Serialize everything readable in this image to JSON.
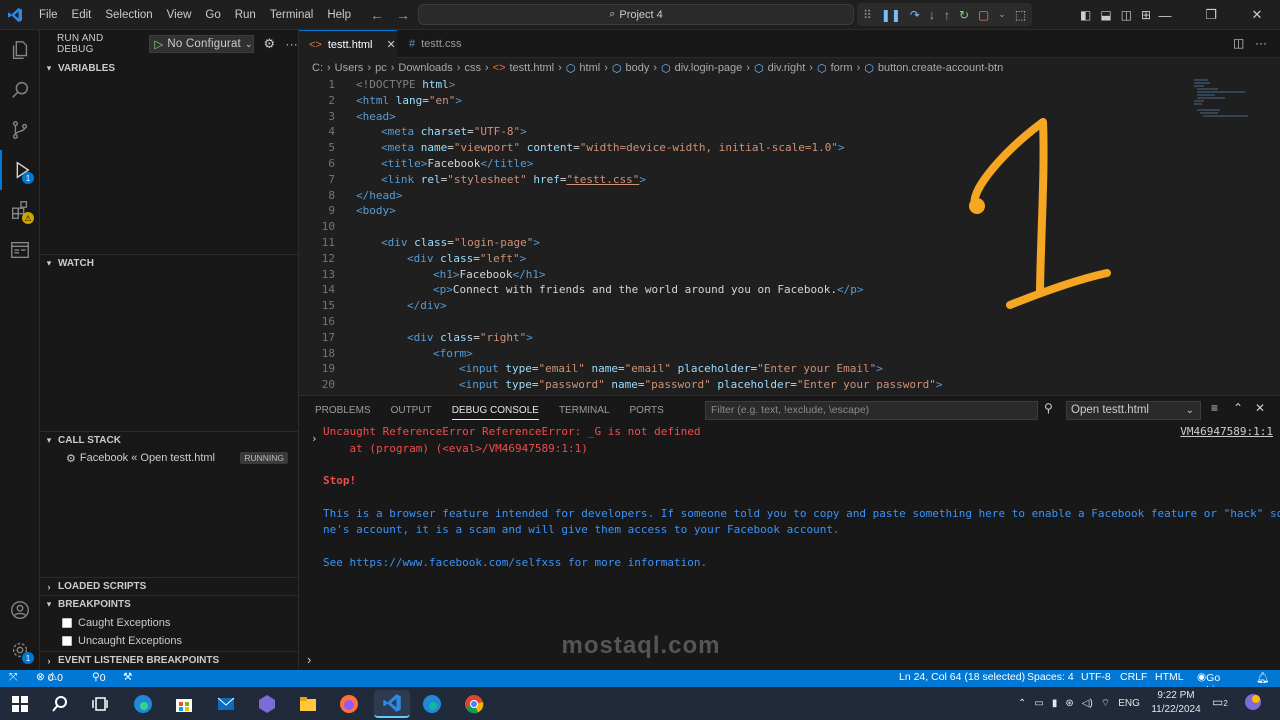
{
  "menu": [
    "File",
    "Edit",
    "Selection",
    "View",
    "Go",
    "Run",
    "Terminal",
    "Help"
  ],
  "command_center": "Project 4",
  "sidebar": {
    "title": "RUN AND DEBUG",
    "config": "No Configurat",
    "sections": {
      "variables": "VARIABLES",
      "watch": "WATCH",
      "call_stack": "CALL STACK",
      "loaded_scripts": "LOADED SCRIPTS",
      "breakpoints": "BREAKPOINTS",
      "event_listener": "EVENT LISTENER BREAKPOINTS"
    },
    "call_stack_item": "Facebook « Open testt.html",
    "call_stack_status": "RUNNING",
    "breakpoints": [
      "Caught Exceptions",
      "Uncaught Exceptions"
    ]
  },
  "activity_badges": {
    "debug": "1"
  },
  "tabs": [
    "testt.html",
    "testt.css"
  ],
  "breadcrumb": [
    "C:",
    "Users",
    "pc",
    "Downloads",
    "css",
    "testt.html",
    "html",
    "body",
    "div.login-page",
    "div.right",
    "form",
    "button.create-account-btn"
  ],
  "code_lines": [
    [
      "1",
      "2",
      "3",
      "4",
      "5",
      "6",
      "7",
      "8",
      "9",
      "10",
      "11",
      "12",
      "13",
      "14",
      "15",
      "16",
      "17",
      "18",
      "19",
      "20"
    ]
  ],
  "code": {
    "l1a": "<!DOCTYPE",
    "l1b": " html",
    "l1c": ">",
    "html_open": "<html",
    "lang_attr": " lang",
    "lang_val": "\"en\"",
    "head_open": "<head>",
    "meta1_tag": "<meta",
    "meta1_attr": " charset",
    "meta1_val": "\"UTF-8\"",
    "meta2_attr1": " name",
    "meta2_val1": "\"viewport\"",
    "meta2_attr2": " content",
    "meta2_val2": "\"width=device-width, initial-scale=1.0\"",
    "title_open": "<title>",
    "title_text": "Facebook",
    "title_close": "</title>",
    "link_tag": "<link",
    "link_rel": " rel",
    "link_rel_val": "\"stylesheet\"",
    "link_href": " href",
    "link_href_val": "\"testt.css\"",
    "head_close": "</head>",
    "body_open": "<body>",
    "div": "<div",
    "class_attr": " class",
    "login_val": "\"login-page\"",
    "left_val": "\"left\"",
    "h1_open": "<h1>",
    "h1_text": "Facebook",
    "h1_close": "</h1>",
    "p_open": "<p>",
    "p_text": "Connect with friends and the world around you on Facebook.",
    "p_close": "</p>",
    "div_close": "</div>",
    "right_val": "\"right\"",
    "form_open": "<form>",
    "input": "<input",
    "type_attr": " type",
    "email_val": "\"email\"",
    "name_attr": " name",
    "placeholder_attr": " placeholder",
    "email_ph": "\"Enter your Email\"",
    "password_val": "\"password\"",
    "password_ph": "\"Enter your password\"",
    "eq": "=",
    "gt": ">"
  },
  "panel": {
    "tabs": [
      "PROBLEMS",
      "OUTPUT",
      "DEBUG CONSOLE",
      "TERMINAL",
      "PORTS"
    ],
    "filter_placeholder": "Filter (e.g. text, !exclude, \\escape)",
    "session": "Open testt.html",
    "error_line1": "Uncaught ReferenceError ReferenceError: _G is not defined",
    "error_line2": "    at (program) (<eval>/VM46947589:1:1)",
    "error_source": "VM46947589:1:1",
    "stop": "Stop!",
    "warn1": "This is a browser feature intended for developers. If someone told you to copy and paste something here to enable a Facebook feature or \"hack\" someo",
    "warn2": "ne's account, it is a scam and will give them access to your Facebook account.",
    "warn3": "See https://www.facebook.com/selfxss for more information."
  },
  "statusbar": {
    "errors": "0",
    "warnings": "0",
    "ports": "0",
    "position": "Ln 24, Col 64 (18 selected)",
    "spaces": "Spaces: 4",
    "encoding": "UTF-8",
    "eol": "CRLF",
    "language": "HTML",
    "golive": "Go Live"
  },
  "taskbar": {
    "lang": "ENG",
    "time": "9:22 PM",
    "date": "11/22/2024",
    "notifications": "2"
  },
  "watermark": "mostaql.com",
  "colors": {
    "accent": "#0078d4",
    "status": "#0078d4",
    "error": "#f14c4c",
    "info": "#3794ff",
    "annotation": "#f5a623"
  }
}
